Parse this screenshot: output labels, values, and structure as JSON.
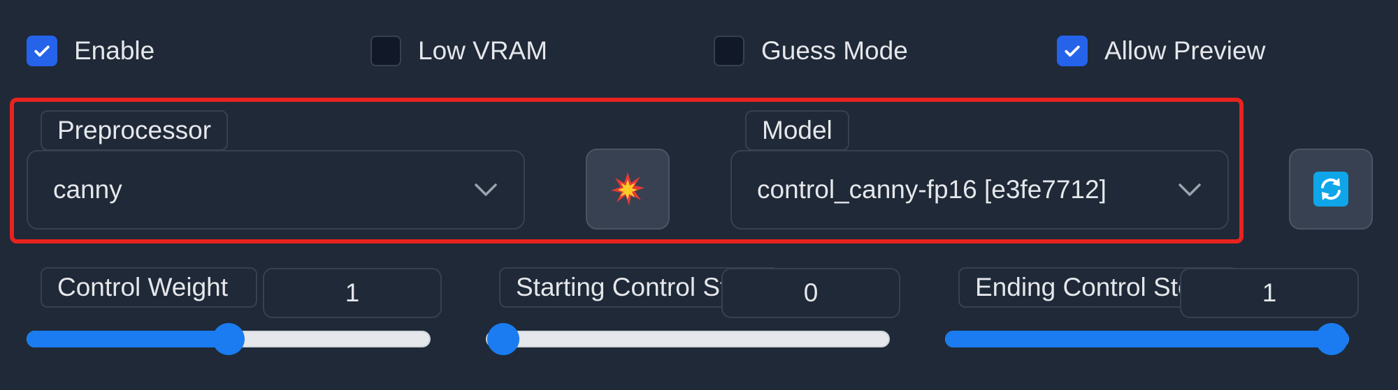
{
  "options": {
    "enable": {
      "label": "Enable",
      "checked": true
    },
    "low_vram": {
      "label": "Low VRAM",
      "checked": false
    },
    "guess_mode": {
      "label": "Guess Mode",
      "checked": false
    },
    "allow_preview": {
      "label": "Allow Preview",
      "checked": true
    }
  },
  "preprocessor": {
    "label": "Preprocessor",
    "value": "canny",
    "run_button_icon": "explosion-icon"
  },
  "model": {
    "label": "Model",
    "value": "control_canny-fp16 [e3fe7712]",
    "refresh_button_icon": "refresh-icon"
  },
  "sliders": {
    "control_weight": {
      "label": "Control Weight",
      "value": "1",
      "fill": 0.5
    },
    "starting_step": {
      "label": "Starting Control Step",
      "value": "0",
      "fill": 0.0
    },
    "ending_step": {
      "label": "Ending Control Step",
      "value": "1",
      "fill": 1.0
    }
  },
  "colors": {
    "background": "#1f2937",
    "accent": "#2563eb",
    "slider": "#1a7cf0",
    "highlight": "#e8231f"
  }
}
